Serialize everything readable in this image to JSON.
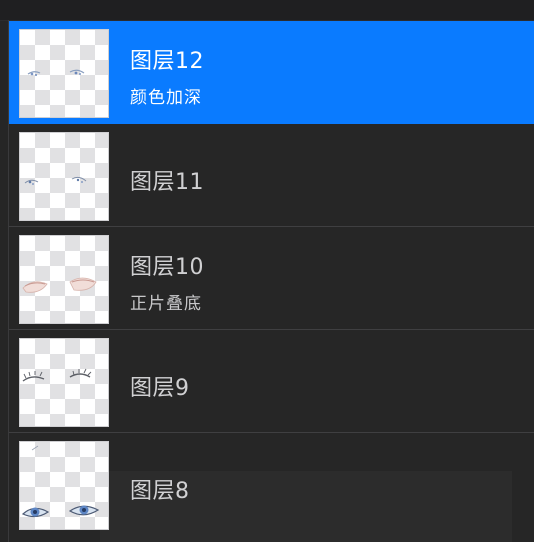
{
  "layers": [
    {
      "name": "图层12",
      "blend_mode": "颜色加深",
      "selected": true,
      "thumbnail": "eyes-outline-blue"
    },
    {
      "name": "图层11",
      "blend_mode": "",
      "selected": false,
      "thumbnail": "eyes-sketch-blue"
    },
    {
      "name": "图层10",
      "blend_mode": "正片叠底",
      "selected": false,
      "thumbnail": "eyes-shadow-pink"
    },
    {
      "name": "图层9",
      "blend_mode": "",
      "selected": false,
      "thumbnail": "eyes-lashes-gray"
    },
    {
      "name": "图层8",
      "blend_mode": "",
      "selected": false,
      "thumbnail": "eyes-color-blue"
    }
  ],
  "colors": {
    "panel_bg": "#262626",
    "selected_bg": "#0a7bff",
    "text": "#d0d0d2",
    "selected_text": "#ffffff"
  }
}
